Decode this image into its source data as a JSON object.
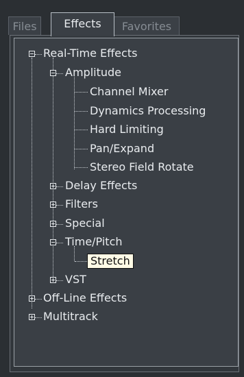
{
  "tabs": [
    {
      "label": "Files",
      "active": false
    },
    {
      "label": "Effects",
      "active": true
    },
    {
      "label": "Favorites",
      "active": false
    }
  ],
  "tree": {
    "realtime": "Real-Time Effects",
    "amplitude": "Amplitude",
    "amp_children": [
      "Channel Mixer",
      "Dynamics Processing",
      "Hard Limiting",
      "Pan/Expand",
      "Stereo Field Rotate"
    ],
    "delay": "Delay Effects",
    "filters": "Filters",
    "special": "Special",
    "timepitch": "Time/Pitch",
    "stretch": "Stretch",
    "vst": "VST",
    "offline": "Off-Line Effects",
    "multitrack": "Multitrack"
  },
  "colors": {
    "background": "#2b2f33",
    "panel": "#3a3f45",
    "text": "#e9ecef",
    "selected_bg": "#fffbe6"
  }
}
